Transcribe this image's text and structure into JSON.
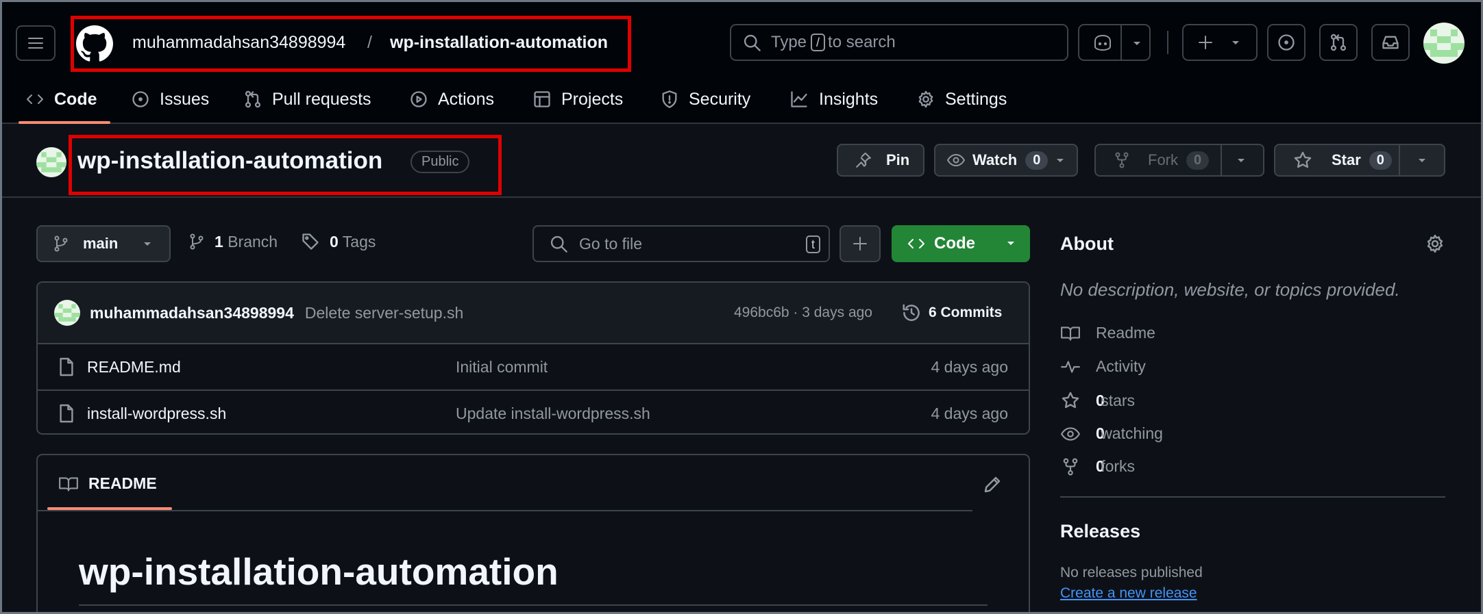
{
  "header": {
    "owner": "muhammadahsan34898994",
    "separator": "/",
    "repo": "wp-installation-automation",
    "search": {
      "prefix": "Type",
      "key": "/",
      "suffix": "to search"
    }
  },
  "tabs": [
    {
      "label": "Code",
      "icon": "code-icon"
    },
    {
      "label": "Issues",
      "icon": "issue-opened-icon"
    },
    {
      "label": "Pull requests",
      "icon": "git-pull-request-icon"
    },
    {
      "label": "Actions",
      "icon": "play-icon"
    },
    {
      "label": "Projects",
      "icon": "table-icon"
    },
    {
      "label": "Security",
      "icon": "shield-icon"
    },
    {
      "label": "Insights",
      "icon": "graph-icon"
    },
    {
      "label": "Settings",
      "icon": "gear-icon"
    }
  ],
  "repo_header": {
    "name": "wp-installation-automation",
    "visibility": "Public",
    "pin": "Pin",
    "watch": {
      "label": "Watch",
      "count": "0"
    },
    "fork": {
      "label": "Fork",
      "count": "0"
    },
    "star": {
      "label": "Star",
      "count": "0"
    }
  },
  "toolbar": {
    "branch": "main",
    "branches_count": "1",
    "branches_label": "Branch",
    "tags_count": "0",
    "tags_label": "Tags",
    "go_to_file": "Go to file",
    "go_to_file_key": "t",
    "code_button": "Code"
  },
  "latest_commit": {
    "author": "muhammadahsan34898994",
    "message": "Delete server-setup.sh",
    "hash_time": "496bc6b · 3 days ago",
    "commits": "6 Commits"
  },
  "files": [
    {
      "name": "README.md",
      "message": "Initial commit",
      "time": "4 days ago"
    },
    {
      "name": "install-wordpress.sh",
      "message": "Update install-wordpress.sh",
      "time": "4 days ago"
    }
  ],
  "readme": {
    "tab_label": "README",
    "heading": "wp-installation-automation"
  },
  "about": {
    "title": "About",
    "description": "No description, website, or topics provided.",
    "readme": "Readme",
    "activity": "Activity",
    "stars_count": "0",
    "stars_label": "stars",
    "watching_count": "0",
    "watching_label": "watching",
    "forks_count": "0",
    "forks_label": "forks",
    "releases_title": "Releases",
    "no_releases": "No releases published",
    "create_release": "Create a new release"
  },
  "colors": {
    "accent_underline": "#fd8c73",
    "annotation_box": "#e00000",
    "code_button": "#238636",
    "link": "#4493f8"
  }
}
